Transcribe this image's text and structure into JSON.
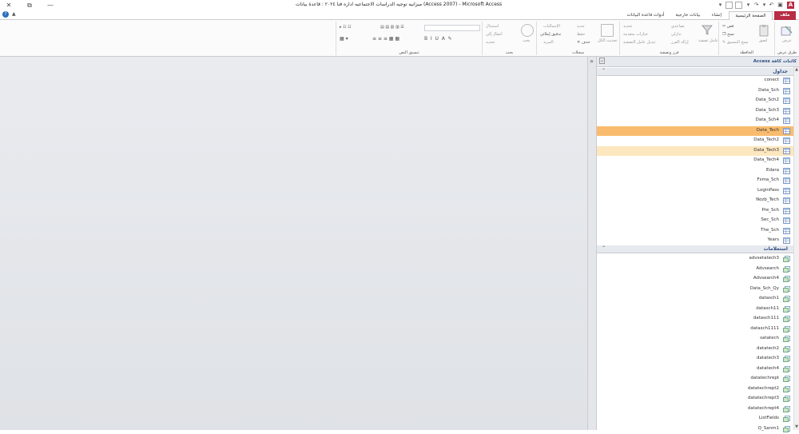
{
  "window": {
    "title": "ميزانيه توجيه الدراسات الاجتماعيه اداره قنا ٢٠٢٤ : قاعدة بيانات (Access 2007) - Microsoft Access"
  },
  "icons": {
    "close": "✕",
    "restore": "⧉",
    "minimize": "—",
    "quickaccess_dropdown": "▾",
    "undo": "↶",
    "redo": "↷",
    "save": "▣",
    "help": "?",
    "collapse_ribbon": "▲",
    "nav_expand": "»",
    "nav_dropdown": "⌄",
    "group_collapse": "⌃"
  },
  "tabs": [
    {
      "label": "ملف"
    },
    {
      "label": "الصفحة الرئيسية"
    },
    {
      "label": "إنشاء"
    },
    {
      "label": "بيانات خارجية"
    },
    {
      "label": "أدوات قاعدة البيانات"
    }
  ],
  "ribbon": {
    "groups": {
      "views": {
        "label": "طرق عرض",
        "view_button": "عرض"
      },
      "clipboard": {
        "label": "الحافظة",
        "paste": "لصق",
        "cut": "قص",
        "copy": "نسخ",
        "format_painter": "نسخ التنسيق"
      },
      "sort_filter": {
        "label": "فرز وتصفية",
        "filter": "عامل تصفية",
        "ascending": "تصاعدي",
        "descending": "تنازلي",
        "remove_sort": "إزالة الفرز",
        "selection": "تحديد",
        "advanced": "خيارات متقدمة",
        "toggle_filter": "تبديل عامل التصفية"
      },
      "records": {
        "label": "سجلات",
        "refresh_all": "تحديث الكل",
        "new": "جديد",
        "save": "حفظ",
        "delete": "حذف",
        "totals": "الإجماليات",
        "spelling": "تدقيق إملائي",
        "more": "المزيد"
      },
      "find": {
        "label": "بحث",
        "find": "بحث",
        "replace": "استبدال",
        "goto": "انتقال إلى",
        "select": "تحديد"
      },
      "text_formatting": {
        "label": "تنسيق النص"
      }
    }
  },
  "nav": {
    "header": "Access كائنات كافة",
    "groups": {
      "tables": {
        "title": "جداول",
        "items": [
          "conect",
          "Data_Sch",
          "Data_Sch2",
          "Data_Sch3",
          "Data_Sch4",
          "Data_Tech",
          "Data_Tech2",
          "Data_Tech3",
          "Data_Tech4",
          "Edara",
          "Fsma_Sch",
          "LoginPass",
          "Nozb_Tech",
          "Pre_Sch",
          "Sec_Sch",
          "The_Sch",
          "Years"
        ]
      },
      "queries": {
        "title": "استعلامات",
        "items": [
          "advsetatech3",
          "Advsearch",
          "Advsearch4",
          "Data_Sch_Qy",
          "datasch1",
          "datasch11",
          "datasch111",
          "datasch1111",
          "satatech",
          "datatech2",
          "datatech3",
          "datatech4",
          "datatechrept",
          "datatechrept2",
          "datatechrept3",
          "datatechrept4",
          "ListFields",
          "Q_Sanm1"
        ]
      }
    }
  },
  "colors": {
    "file_tab": "#b62d44",
    "selected_item": "#f9bc6e",
    "hover_item": "#fde7bf",
    "group_title": "#2b4b7e",
    "workspace": "#e4e7eb"
  }
}
